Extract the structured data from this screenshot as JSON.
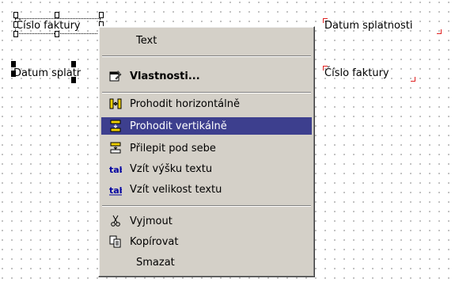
{
  "canvas": {
    "fields": [
      {
        "id": "cislo_left",
        "text": "Číslo faktury"
      },
      {
        "id": "datum_left",
        "text": "Datum splatr"
      },
      {
        "id": "datum_right",
        "text": "Datum splatnosti"
      },
      {
        "id": "cislo_right",
        "text": "Číslo faktury"
      }
    ]
  },
  "context_menu": {
    "items": [
      {
        "label": "Text",
        "icon": "none"
      },
      {
        "label": "Vlastnosti...",
        "icon": "properties-icon"
      },
      {
        "label": "Prohodit horizontálně",
        "icon": "swap-horizontal-icon"
      },
      {
        "label": "Prohodit vertikálně",
        "icon": "swap-vertical-icon",
        "highlighted": true
      },
      {
        "label": "Přilepit pod sebe",
        "icon": "stack-below-icon"
      },
      {
        "label": "Vzít výšku textu",
        "icon": "text-height-icon"
      },
      {
        "label": "Vzít velikost textu",
        "icon": "text-size-icon"
      },
      {
        "label": "Vyjmout",
        "icon": "cut-icon"
      },
      {
        "label": "Kopírovat",
        "icon": "copy-icon"
      },
      {
        "label": "Smazat",
        "icon": "none"
      }
    ],
    "highlight_color": "#3d3f8e"
  }
}
